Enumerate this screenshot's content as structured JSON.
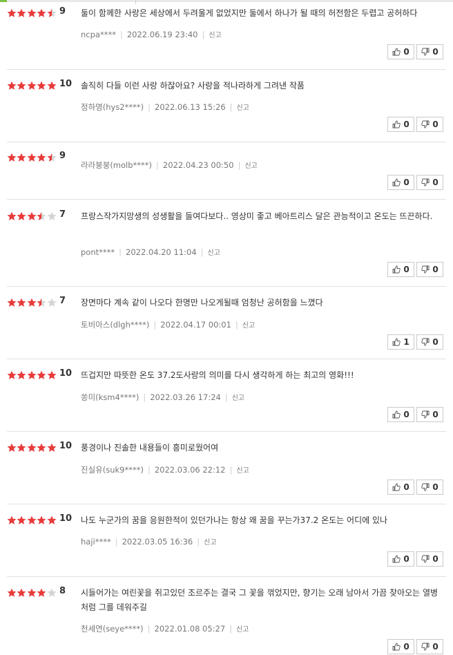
{
  "colors": {
    "star_on": "#e83b3b",
    "star_off": "#d4d4d4",
    "accent": "#7ac142"
  },
  "report_label": "신고",
  "reviews": [
    {
      "stars": 4.5,
      "score": "9",
      "text": "둘이 함께한 사랑은 세상에서 두려울게 없었지만 둘에서 하나가 될 때의 허전함은 두렵고 공허하다",
      "user": "ncpa****",
      "date": "2022.06.19 23:40",
      "likes": "0",
      "dislikes": "0"
    },
    {
      "stars": 5,
      "score": "10",
      "text": "솔직히 다들 이런 사랑 하잖아요? 사랑을 적나라하게 그려낸 작품",
      "user": "정하영(hys2****)",
      "date": "2022.06.13 15:26",
      "likes": "0",
      "dislikes": "0"
    },
    {
      "stars": 4.5,
      "score": "9",
      "text": "",
      "user": "라라붕붕(molb****)",
      "date": "2022.04.23 00:50",
      "likes": "0",
      "dislikes": "0"
    },
    {
      "stars": 3.5,
      "score": "7",
      "text": "프랑스작가지망생의 성생활을 들여다보다.. 영상미 좋고 베아트리스 달은 관능적이고 온도는 뜨끈하다.",
      "user": "pont****",
      "date": "2022.04.20 11:04",
      "likes": "0",
      "dislikes": "0"
    },
    {
      "stars": 3.5,
      "score": "7",
      "text": "장면마다 계속 같이 나오다 한명만 나오게될때 엄청난 공허함을 느꼈다",
      "user": "토비아스(dlgh****)",
      "date": "2022.04.17 00:01",
      "likes": "1",
      "dislikes": "0"
    },
    {
      "stars": 5,
      "score": "10",
      "text": "뜨겁지만 따뜻한 온도 37.2도사랑의 의미를 다시 생각하게 하는 최고의 영화!!!",
      "user": "쏭미(ksm4****)",
      "date": "2022.03.26 17:24",
      "likes": "0",
      "dislikes": "0"
    },
    {
      "stars": 5,
      "score": "10",
      "text": "풍경이나 진솔한 내용들이 흥미로웠어여",
      "user": "진실유(suk9****)",
      "date": "2022.03.06 22:12",
      "likes": "0",
      "dislikes": "0"
    },
    {
      "stars": 5,
      "score": "10",
      "text": "나도 누군가의 꿈을 응원한적이 있던가나는 항상 왜 꿈을 꾸는가37.2 온도는 어디에 있나",
      "user": "haji****",
      "date": "2022.03.05 16:36",
      "likes": "0",
      "dislikes": "0"
    },
    {
      "stars": 4,
      "score": "8",
      "text": "시들어가는 여린꽃을 쥐고있던 조르주는 결국 그 꽃을 꺾었지만, 향기는 오래 남아서 가끔 찾아오는 열병처럼 그를 데워주길",
      "user": "천세연(seye****)",
      "date": "2022.01.08 05:27",
      "likes": "0",
      "dislikes": "0"
    }
  ]
}
